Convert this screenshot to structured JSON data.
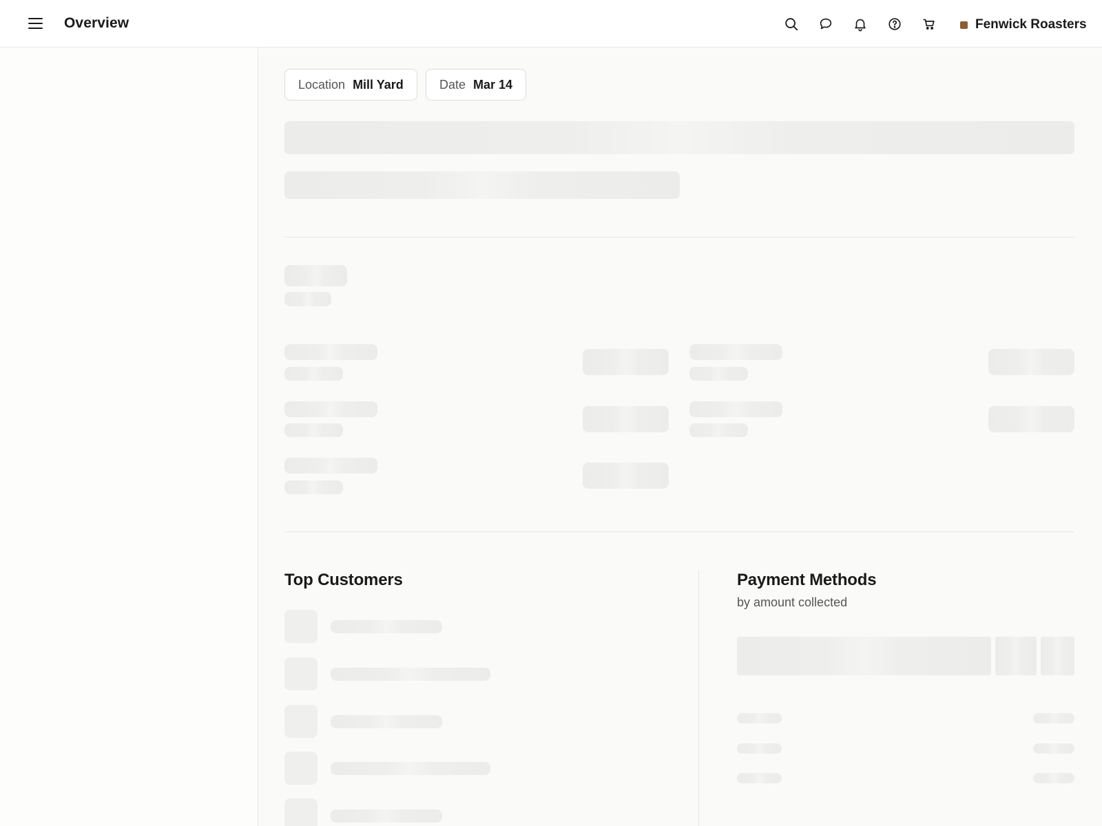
{
  "header": {
    "title": "Overview",
    "icons": [
      "search-icon",
      "message-icon",
      "bell-icon",
      "help-icon",
      "cart-icon"
    ],
    "brand": {
      "name": "Fenwick Roasters",
      "color": "#8b5e34"
    }
  },
  "filters": {
    "location": {
      "label": "Location",
      "value": "Mill Yard"
    },
    "date": {
      "label": "Date",
      "value": "Mar 14"
    }
  },
  "top_customers": {
    "title": "Top Customers"
  },
  "payment_methods": {
    "title": "Payment Methods",
    "subtitle": "by amount collected"
  },
  "state": "loading"
}
